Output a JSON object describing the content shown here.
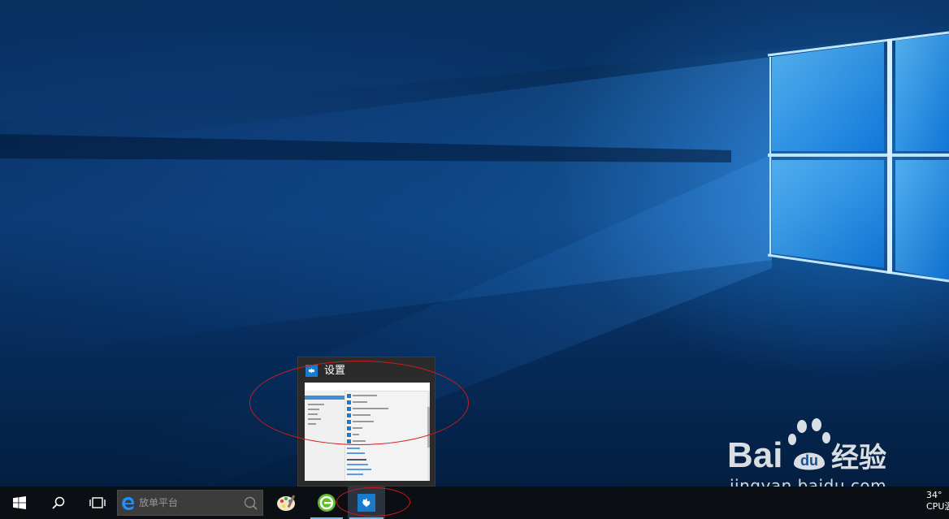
{
  "desktop": {
    "wallpaper": "Windows 10 hero wallpaper",
    "accent_color": "#1979ca"
  },
  "preview": {
    "title": "设置",
    "icon": "gear-icon"
  },
  "taskbar": {
    "start_icon": "windows-logo-icon",
    "search_button_icon": "search-icon",
    "task_view_icon": "task-view-icon",
    "search_placeholder": "放单平台",
    "search_box_icon": "edge-e-icon",
    "apps": [
      {
        "name": "paint-app-icon",
        "running": false
      },
      {
        "name": "360-browser-icon",
        "running": true
      },
      {
        "name": "settings-gear-icon",
        "running": true,
        "active": true
      }
    ],
    "tray_line1": "34°",
    "tray_line2": "CPU温"
  },
  "watermark": {
    "logo_text": "Bai 经验",
    "url": "jingyan.baidu.com"
  },
  "annotations": {
    "color": "#d31a1a"
  }
}
